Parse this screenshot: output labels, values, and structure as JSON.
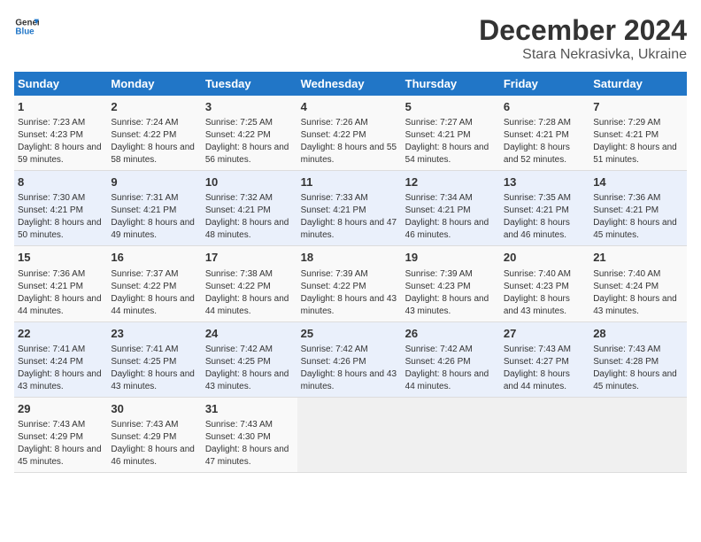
{
  "header": {
    "logo_general": "General",
    "logo_blue": "Blue",
    "title": "December 2024",
    "subtitle": "Stara Nekrasivka, Ukraine"
  },
  "calendar": {
    "days_of_week": [
      "Sunday",
      "Monday",
      "Tuesday",
      "Wednesday",
      "Thursday",
      "Friday",
      "Saturday"
    ],
    "weeks": [
      [
        {
          "day": "1",
          "sunrise": "Sunrise: 7:23 AM",
          "sunset": "Sunset: 4:23 PM",
          "daylight": "Daylight: 8 hours and 59 minutes."
        },
        {
          "day": "2",
          "sunrise": "Sunrise: 7:24 AM",
          "sunset": "Sunset: 4:22 PM",
          "daylight": "Daylight: 8 hours and 58 minutes."
        },
        {
          "day": "3",
          "sunrise": "Sunrise: 7:25 AM",
          "sunset": "Sunset: 4:22 PM",
          "daylight": "Daylight: 8 hours and 56 minutes."
        },
        {
          "day": "4",
          "sunrise": "Sunrise: 7:26 AM",
          "sunset": "Sunset: 4:22 PM",
          "daylight": "Daylight: 8 hours and 55 minutes."
        },
        {
          "day": "5",
          "sunrise": "Sunrise: 7:27 AM",
          "sunset": "Sunset: 4:21 PM",
          "daylight": "Daylight: 8 hours and 54 minutes."
        },
        {
          "day": "6",
          "sunrise": "Sunrise: 7:28 AM",
          "sunset": "Sunset: 4:21 PM",
          "daylight": "Daylight: 8 hours and 52 minutes."
        },
        {
          "day": "7",
          "sunrise": "Sunrise: 7:29 AM",
          "sunset": "Sunset: 4:21 PM",
          "daylight": "Daylight: 8 hours and 51 minutes."
        }
      ],
      [
        {
          "day": "8",
          "sunrise": "Sunrise: 7:30 AM",
          "sunset": "Sunset: 4:21 PM",
          "daylight": "Daylight: 8 hours and 50 minutes."
        },
        {
          "day": "9",
          "sunrise": "Sunrise: 7:31 AM",
          "sunset": "Sunset: 4:21 PM",
          "daylight": "Daylight: 8 hours and 49 minutes."
        },
        {
          "day": "10",
          "sunrise": "Sunrise: 7:32 AM",
          "sunset": "Sunset: 4:21 PM",
          "daylight": "Daylight: 8 hours and 48 minutes."
        },
        {
          "day": "11",
          "sunrise": "Sunrise: 7:33 AM",
          "sunset": "Sunset: 4:21 PM",
          "daylight": "Daylight: 8 hours and 47 minutes."
        },
        {
          "day": "12",
          "sunrise": "Sunrise: 7:34 AM",
          "sunset": "Sunset: 4:21 PM",
          "daylight": "Daylight: 8 hours and 46 minutes."
        },
        {
          "day": "13",
          "sunrise": "Sunrise: 7:35 AM",
          "sunset": "Sunset: 4:21 PM",
          "daylight": "Daylight: 8 hours and 46 minutes."
        },
        {
          "day": "14",
          "sunrise": "Sunrise: 7:36 AM",
          "sunset": "Sunset: 4:21 PM",
          "daylight": "Daylight: 8 hours and 45 minutes."
        }
      ],
      [
        {
          "day": "15",
          "sunrise": "Sunrise: 7:36 AM",
          "sunset": "Sunset: 4:21 PM",
          "daylight": "Daylight: 8 hours and 44 minutes."
        },
        {
          "day": "16",
          "sunrise": "Sunrise: 7:37 AM",
          "sunset": "Sunset: 4:22 PM",
          "daylight": "Daylight: 8 hours and 44 minutes."
        },
        {
          "day": "17",
          "sunrise": "Sunrise: 7:38 AM",
          "sunset": "Sunset: 4:22 PM",
          "daylight": "Daylight: 8 hours and 44 minutes."
        },
        {
          "day": "18",
          "sunrise": "Sunrise: 7:39 AM",
          "sunset": "Sunset: 4:22 PM",
          "daylight": "Daylight: 8 hours and 43 minutes."
        },
        {
          "day": "19",
          "sunrise": "Sunrise: 7:39 AM",
          "sunset": "Sunset: 4:23 PM",
          "daylight": "Daylight: 8 hours and 43 minutes."
        },
        {
          "day": "20",
          "sunrise": "Sunrise: 7:40 AM",
          "sunset": "Sunset: 4:23 PM",
          "daylight": "Daylight: 8 hours and 43 minutes."
        },
        {
          "day": "21",
          "sunrise": "Sunrise: 7:40 AM",
          "sunset": "Sunset: 4:24 PM",
          "daylight": "Daylight: 8 hours and 43 minutes."
        }
      ],
      [
        {
          "day": "22",
          "sunrise": "Sunrise: 7:41 AM",
          "sunset": "Sunset: 4:24 PM",
          "daylight": "Daylight: 8 hours and 43 minutes."
        },
        {
          "day": "23",
          "sunrise": "Sunrise: 7:41 AM",
          "sunset": "Sunset: 4:25 PM",
          "daylight": "Daylight: 8 hours and 43 minutes."
        },
        {
          "day": "24",
          "sunrise": "Sunrise: 7:42 AM",
          "sunset": "Sunset: 4:25 PM",
          "daylight": "Daylight: 8 hours and 43 minutes."
        },
        {
          "day": "25",
          "sunrise": "Sunrise: 7:42 AM",
          "sunset": "Sunset: 4:26 PM",
          "daylight": "Daylight: 8 hours and 43 minutes."
        },
        {
          "day": "26",
          "sunrise": "Sunrise: 7:42 AM",
          "sunset": "Sunset: 4:26 PM",
          "daylight": "Daylight: 8 hours and 44 minutes."
        },
        {
          "day": "27",
          "sunrise": "Sunrise: 7:43 AM",
          "sunset": "Sunset: 4:27 PM",
          "daylight": "Daylight: 8 hours and 44 minutes."
        },
        {
          "day": "28",
          "sunrise": "Sunrise: 7:43 AM",
          "sunset": "Sunset: 4:28 PM",
          "daylight": "Daylight: 8 hours and 45 minutes."
        }
      ],
      [
        {
          "day": "29",
          "sunrise": "Sunrise: 7:43 AM",
          "sunset": "Sunset: 4:29 PM",
          "daylight": "Daylight: 8 hours and 45 minutes."
        },
        {
          "day": "30",
          "sunrise": "Sunrise: 7:43 AM",
          "sunset": "Sunset: 4:29 PM",
          "daylight": "Daylight: 8 hours and 46 minutes."
        },
        {
          "day": "31",
          "sunrise": "Sunrise: 7:43 AM",
          "sunset": "Sunset: 4:30 PM",
          "daylight": "Daylight: 8 hours and 47 minutes."
        },
        null,
        null,
        null,
        null
      ]
    ]
  }
}
